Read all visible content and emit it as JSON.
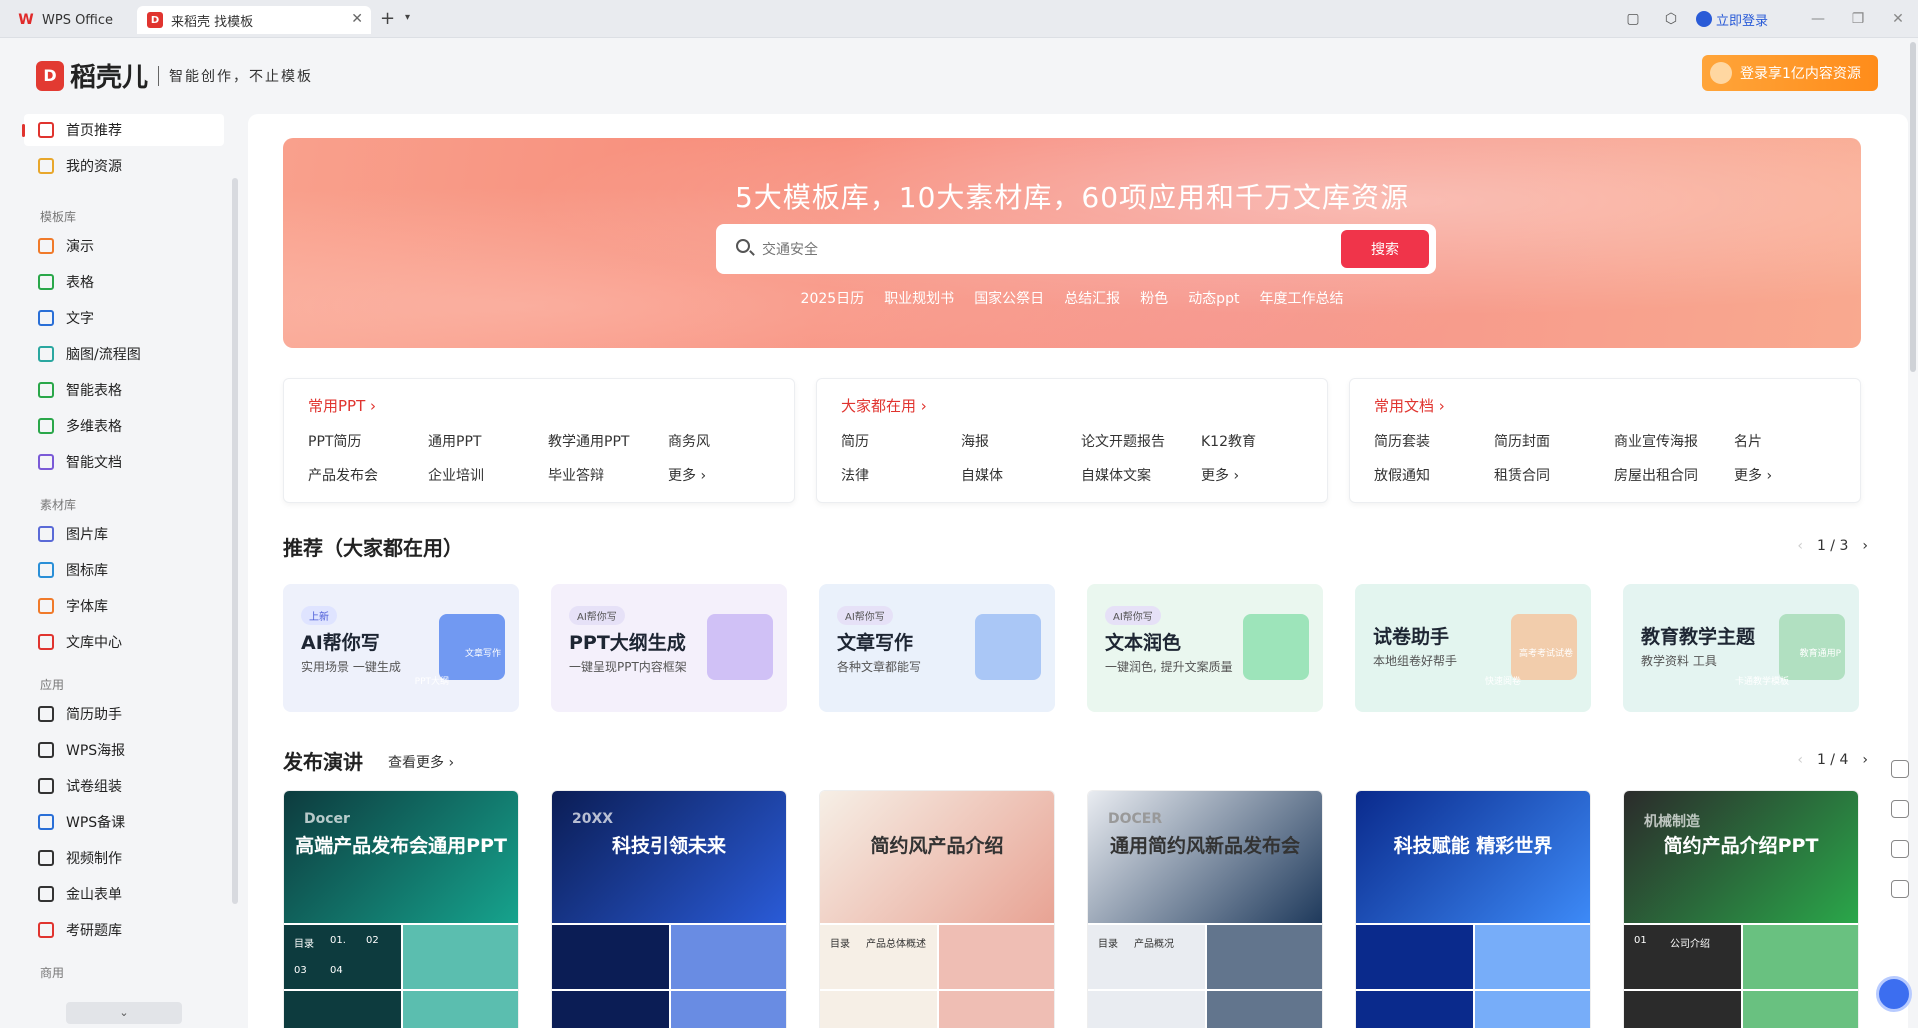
{
  "titlebar": {
    "tabs": [
      {
        "label": "WPS Office"
      },
      {
        "label": "来稻壳 找模板"
      }
    ],
    "login": "立即登录"
  },
  "header": {
    "logo": "稻壳儿",
    "slogan": "智能创作，不止模板",
    "promo": "登录享1亿内容资源"
  },
  "sidebar": {
    "top": [
      {
        "label": "首页推荐",
        "color": "#e0342f"
      },
      {
        "label": "我的资源",
        "color": "#e8a72c"
      }
    ],
    "groups": [
      {
        "title": "模板库",
        "items": [
          {
            "label": "演示",
            "color": "#f07a2a"
          },
          {
            "label": "表格",
            "color": "#2aa74a"
          },
          {
            "label": "文字",
            "color": "#2a6fd7"
          },
          {
            "label": "脑图/流程图",
            "color": "#2aa7a0"
          },
          {
            "label": "智能表格",
            "color": "#2aa74a"
          },
          {
            "label": "多维表格",
            "color": "#2aa74a"
          },
          {
            "label": "智能文档",
            "color": "#7a5ad7"
          }
        ]
      },
      {
        "title": "素材库",
        "items": [
          {
            "label": "图片库",
            "color": "#5a6ad7"
          },
          {
            "label": "图标库",
            "color": "#2a8fd7"
          },
          {
            "label": "字体库",
            "color": "#f07a2a"
          },
          {
            "label": "文库中心",
            "color": "#e0342f"
          }
        ]
      },
      {
        "title": "应用",
        "items": [
          {
            "label": "简历助手",
            "color": "#333333"
          },
          {
            "label": "WPS海报",
            "color": "#333333"
          },
          {
            "label": "试卷组装",
            "color": "#333333"
          },
          {
            "label": "WPS备课",
            "color": "#2a6fd7"
          },
          {
            "label": "视频制作",
            "color": "#333333"
          },
          {
            "label": "金山表单",
            "color": "#333333"
          },
          {
            "label": "考研题库",
            "color": "#e0342f"
          }
        ]
      },
      {
        "title": "商用",
        "items": []
      }
    ]
  },
  "hero": {
    "title": "5大模板库，10大素材库，60项应用和千万文库资源",
    "search_placeholder": "交通安全",
    "search_btn": "搜索",
    "hot": [
      "2025日历",
      "职业规划书",
      "国家公祭日",
      "总结汇报",
      "粉色",
      "动态ppt",
      "年度工作总结"
    ]
  },
  "categories": [
    {
      "title": "常用PPT",
      "items": [
        "PPT简历",
        "通用PPT",
        "教学通用PPT",
        "商务风",
        "产品发布会",
        "企业培训",
        "毕业答辩",
        "更多"
      ]
    },
    {
      "title": "大家都在用",
      "items": [
        "简历",
        "海报",
        "论文开题报告",
        "K12教育",
        "法律",
        "自媒体",
        "自媒体文案",
        "更多"
      ]
    },
    {
      "title": "常用文档",
      "items": [
        "简历套装",
        "简历封面",
        "商业宣传海报",
        "名片",
        "放假通知",
        "租赁合同",
        "房屋出租合同",
        "更多"
      ]
    }
  ],
  "recommend": {
    "title": "推荐（大家都在用）",
    "pager": "1 / 3",
    "cards": [
      {
        "badge": "上新",
        "title": "AI帮你写",
        "sub": "实用场景 一键生成",
        "bg": "#eef1fb",
        "art": "#5a8af0",
        "art_labels": [
          "文章写作",
          "PPT大纲"
        ]
      },
      {
        "badge": "AI帮你写",
        "title": "PPT大纲生成",
        "sub": "一键呈现PPT内容框架",
        "bg": "#f4f0fb",
        "art": "#c9b8f5"
      },
      {
        "badge": "AI帮你写",
        "title": "文章写作",
        "sub": "各种文章都能写",
        "bg": "#eaf1fb",
        "art": "#9fc0f5"
      },
      {
        "badge": "AI帮你写",
        "title": "文本润色",
        "sub": "一键润色, 提升文案质量",
        "bg": "#eaf7ef",
        "art": "#8fe0b0"
      },
      {
        "badge": "",
        "title": "试卷助手",
        "sub": "本地组卷好帮手",
        "bg": "#e3f5ef",
        "art": "#f4c6a0",
        "art_labels": [
          "高考考试试卷",
          "快速阅卷"
        ]
      },
      {
        "badge": "",
        "title": "教育教学主题",
        "sub": "教学资料 工具",
        "bg": "#e4f4f1",
        "art": "#a8dcb8",
        "art_labels": [
          "教育通用P",
          "卡通教学模板"
        ]
      }
    ]
  },
  "release": {
    "title": "发布演讲",
    "more": "查看更多",
    "pager": "1 / 4",
    "cards": [
      {
        "title": "高端产品发布会通用PPT",
        "bg": "#0d3b3e",
        "accent": "#16a38d",
        "sub_text": "Docer",
        "thumb_labels": [
          "目录",
          "01.",
          "02",
          "03",
          "04"
        ]
      },
      {
        "title": "科技引领未来",
        "bg": "#0b1d55",
        "accent": "#2a5bd7",
        "sub_text": "20XX"
      },
      {
        "title": "简约风产品介绍",
        "bg": "#f6efe6",
        "accent": "#e8a394",
        "sub_text": "",
        "thumb_labels": [
          "目录",
          "产品总体概述"
        ]
      },
      {
        "title": "通用简约风新品发布会",
        "bg": "#e9ecf1",
        "accent": "#1f3a5c",
        "sub_text": "DOCER",
        "thumb_labels": [
          "目录",
          "产品概况"
        ]
      },
      {
        "title": "科技赋能 精彩世界",
        "bg": "#0a2a8c",
        "accent": "#3d8af7",
        "sub_text": ""
      },
      {
        "title": "简约产品介绍PPT",
        "bg": "#2b2b2b",
        "accent": "#2aa74a",
        "sub_text": "机械制造",
        "thumb_labels": [
          "01",
          "公司介绍"
        ]
      }
    ]
  }
}
